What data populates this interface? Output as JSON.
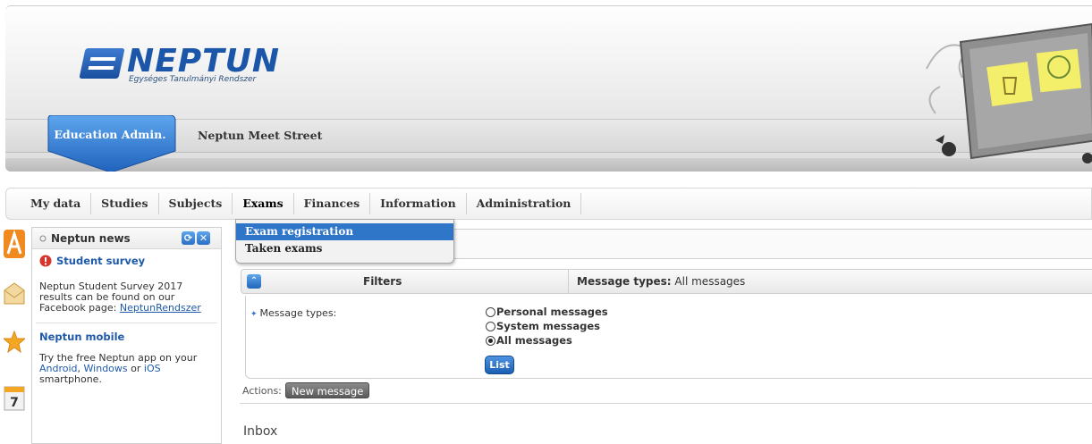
{
  "header": {
    "logo_text": "NEPTUN",
    "logo_subtitle": "Egységes Tanulmányi Rendszer",
    "role_tab": "Education Admin.",
    "site_name": "Neptun Meet Street"
  },
  "nav": {
    "items": [
      {
        "label": "My data"
      },
      {
        "label": "Studies"
      },
      {
        "label": "Subjects"
      },
      {
        "label": "Exams"
      },
      {
        "label": "Finances"
      },
      {
        "label": "Information"
      },
      {
        "label": "Administration"
      }
    ],
    "active": "Exams",
    "dropdown": {
      "items": [
        {
          "label": "Exam registration",
          "highlighted": true
        },
        {
          "label": "Taken exams",
          "highlighted": false
        }
      ]
    }
  },
  "sidebar_icons": [
    {
      "icon": "a-letter-icon"
    },
    {
      "icon": "envelope-icon"
    },
    {
      "icon": "star-icon"
    },
    {
      "icon": "calendar-icon",
      "text": "7"
    }
  ],
  "news": {
    "title": "Neptun news",
    "sections": [
      {
        "heading": "Student survey",
        "text": "Neptun Student Survey 2017 results can be found on our Facebook page: ",
        "link": "NeptunRendszer"
      },
      {
        "heading": "Neptun mobile",
        "text_before": "Try the free Neptun app on your ",
        "link1": "Android",
        "sep1": ", ",
        "link2": "Windows",
        "sep2": " or ",
        "link3": "iOS",
        "text_after": " smartphone."
      }
    ]
  },
  "filters": {
    "label": "Filters",
    "summary_label": "Message types:",
    "summary_value": " All messages",
    "field_label": "Message types:",
    "options": [
      {
        "label": "Personal messages",
        "selected": false
      },
      {
        "label": "System messages",
        "selected": false
      },
      {
        "label": "All messages",
        "selected": true
      }
    ],
    "list_button": "List"
  },
  "actions": {
    "label": "Actions:",
    "new_message": "New message"
  },
  "inbox": {
    "title": "Inbox"
  },
  "colors": {
    "brand_blue": "#1c56a8",
    "highlight": "#2f76c8"
  }
}
